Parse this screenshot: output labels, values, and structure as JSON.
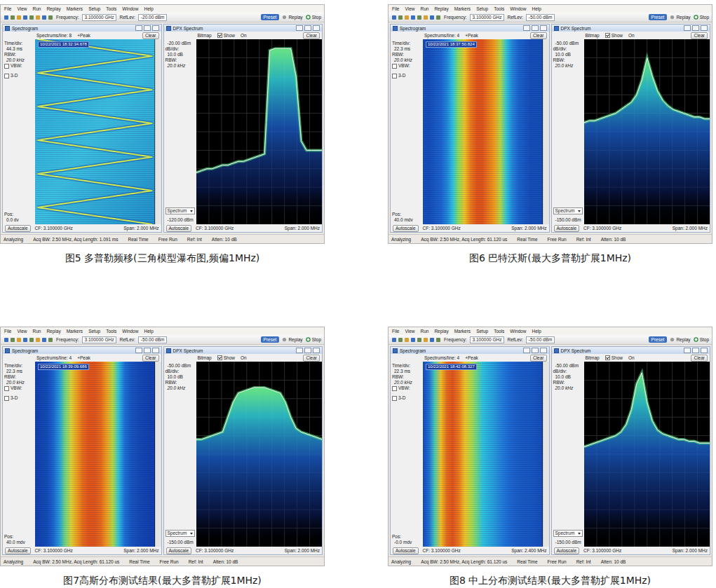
{
  "figures": [
    {
      "caption": "图5 多普勒频移(三角模型瀑布图,频偏1MHz)",
      "menu": [
        "File",
        "View",
        "Run",
        "Replay",
        "Markers",
        "Setup",
        "Tools",
        "Window",
        "Help"
      ],
      "toolbar": {
        "frequency_label": "Frequency:",
        "frequency": "3.100000 GHz",
        "reflev_label": "RefLev:",
        "reflev": "-20.00 dBm",
        "preset": "Preset",
        "replay": "Replay",
        "stop": "Stop"
      },
      "spectrogram": {
        "title": "Spectrogram",
        "spectrums_line": "Spectrums/line: 8",
        "detector": "+Peak",
        "clear": "Clear",
        "time_div_label": "Time/div:",
        "time_div": "44.3 ms",
        "rbw_label": "RBW:",
        "rbw": "20.0 kHz",
        "vbw_label": "VBW:",
        "vbw_checked": false,
        "three_d_label": "3-D",
        "three_d_checked": false,
        "pos_label": "Pos:",
        "pos": "0.0 dv",
        "timestamp": "10/22/2021 18:32:34.678",
        "autoscale": "Autoscale",
        "cf": "CF: 3.100000 GHz",
        "span": "Span: 2.000 MHz",
        "kind": "sweep",
        "track": [
          0.02,
          0.98,
          0.02,
          0.98,
          0.02,
          0.98,
          0.02,
          0.98,
          0.02,
          0.98,
          0.02,
          0.98
        ]
      },
      "dpx": {
        "title": "DPX Spectrum",
        "bitmap": "Bitmap",
        "show_label": "Show",
        "show_checked": true,
        "on": "On",
        "clear": "Clear",
        "ref_level": "-20.00 dBm",
        "db_div_label": "dB/div:",
        "db_div": "10.0 dB",
        "rbw_label": "RBW:",
        "rbw": "20.0 kHz",
        "trace_select": "Spectrum",
        "bottom_level": "-120.00 dBm",
        "autoscale": "Autoscale",
        "cf": "CF: 3.100000 GHz",
        "span": "Span: 2.000 MHz",
        "top_dbm": -20,
        "bottom_dbm": -120,
        "trace": [
          -92,
          -91,
          -90,
          -90,
          -89,
          -88,
          -88,
          -87,
          -86,
          -86,
          -85,
          -84,
          -83,
          -82,
          -26,
          -25,
          -25,
          -25,
          -25,
          -40,
          -75,
          -80,
          -80,
          -80,
          -80
        ]
      },
      "status": [
        "Analyzing",
        "Acq BW: 2.50 MHz, Acq Length: 1.091 ms",
        "Real Time",
        "Free Run",
        "Ref: Int",
        "Atten: 10 dB"
      ]
    },
    {
      "caption": "图6 巴特沃斯(最大多普勒扩展1MHz)",
      "menu": [
        "File",
        "View",
        "Run",
        "Replay",
        "Markers",
        "Setup",
        "Tools",
        "Window",
        "Help"
      ],
      "toolbar": {
        "frequency_label": "Frequency:",
        "frequency": "3.100000 GHz",
        "reflev_label": "RefLev:",
        "reflev": "-50.00 dBm",
        "preset": "Preset",
        "replay": "Replay",
        "stop": "Stop"
      },
      "spectrogram": {
        "title": "Spectrogram",
        "spectrums_line": "Spectrums/line: 4",
        "detector": "+Peak",
        "clear": "Clear",
        "time_div_label": "Time/div:",
        "time_div": "22.3 ms",
        "rbw_label": "RBW:",
        "rbw": "20.0 kHz",
        "vbw_label": "VBW:",
        "vbw_checked": false,
        "three_d_label": "3-D",
        "three_d_checked": false,
        "pos_label": "Pos:",
        "pos": "40.0 mdv",
        "timestamp": "10/22/2021 18:37:50.824",
        "autoscale": "Autoscale",
        "cf": "CF: 3.100000 GHz",
        "span": "Span: 2.000 MHz",
        "kind": "band",
        "profile": [
          0.15,
          0.15,
          0.2,
          0.25,
          0.35,
          0.5,
          0.65,
          0.8,
          0.9,
          0.95,
          0.95,
          0.9,
          0.85,
          0.7,
          0.5,
          0.35,
          0.25,
          0.2,
          0.15,
          0.15,
          0.15
        ]
      },
      "dpx": {
        "title": "DPX Spectrum",
        "bitmap": "Bitmap",
        "show_label": "Show",
        "show_checked": true,
        "on": "On",
        "clear": "Clear",
        "ref_level": "-50.00 dBm",
        "db_div_label": "dB/div:",
        "db_div": "10.0 dB",
        "rbw_label": "RBW:",
        "rbw": "20.0 kHz",
        "trace_select": "Spectrum",
        "bottom_level": "-150.00 dBm",
        "autoscale": "Autoscale",
        "cf": "CF: 3.100000 GHz",
        "span": "Span: 2.000 MHz",
        "top_dbm": -50,
        "bottom_dbm": -150,
        "trace": [
          -95,
          -94,
          -94,
          -93,
          -92,
          -91,
          -90,
          -88,
          -86,
          -84,
          -80,
          -72,
          -60,
          -70,
          -78,
          -83,
          -86,
          -88,
          -89,
          -90,
          -91,
          -92,
          -92,
          -93,
          -93
        ]
      },
      "status": [
        "Analyzing",
        "Acq BW: 2.50 MHz, Acq Length: 61.120 us",
        "Real Time",
        "Free Run",
        "Ref: Int",
        "Atten: 10 dB"
      ]
    },
    {
      "caption": "图7高斯分布测试结果(最大多普勒扩展1MHz)",
      "menu": [
        "File",
        "View",
        "Run",
        "Replay",
        "Markers",
        "Setup",
        "Tools",
        "Window",
        "Help"
      ],
      "toolbar": {
        "frequency_label": "Frequency:",
        "frequency": "3.100000 GHz",
        "reflev_label": "RefLev:",
        "reflev": "-50.00 dBm",
        "preset": "Preset",
        "replay": "Replay",
        "stop": "Stop"
      },
      "spectrogram": {
        "title": "Spectrogram",
        "spectrums_line": "Spectrums/line: 4",
        "detector": "+Peak",
        "clear": "Clear",
        "time_div_label": "Time/div:",
        "time_div": "22.3 ms",
        "rbw_label": "RBW:",
        "rbw": "20.0 kHz",
        "vbw_label": "VBW:",
        "vbw_checked": false,
        "three_d_label": "3-D",
        "three_d_checked": false,
        "pos_label": "Pos:",
        "pos": "40.0 mdv",
        "timestamp": "10/22/2021 18:39:09.686",
        "autoscale": "Autoscale",
        "cf": "CF: 3.100000 GHz",
        "span": "Span: 2.000 MHz",
        "kind": "band",
        "profile": [
          0.1,
          0.12,
          0.15,
          0.25,
          0.4,
          0.6,
          0.75,
          0.85,
          0.92,
          0.95,
          0.95,
          0.92,
          0.85,
          0.7,
          0.5,
          0.3,
          0.2,
          0.15,
          0.12,
          0.1,
          0.1
        ]
      },
      "dpx": {
        "title": "DPX Spectrum",
        "bitmap": "Bitmap",
        "show_label": "Show",
        "show_checked": true,
        "on": "On",
        "clear": "Clear",
        "ref_level": "-50.00 dBm",
        "db_div_label": "dB/div:",
        "db_div": "10.0 dB",
        "rbw_label": "RBW:",
        "rbw": "20.0 kHz",
        "trace_select": "Spectrum",
        "bottom_level": "-150.00 dBm",
        "autoscale": "Autoscale",
        "cf": "CF: 3.100000 GHz",
        "span": "Span: 2.000 MHz",
        "top_dbm": -50,
        "bottom_dbm": -150,
        "trace": [
          -92,
          -92,
          -91,
          -90,
          -89,
          -88,
          -80,
          -72,
          -67,
          -66,
          -65,
          -64,
          -64,
          -64,
          -65,
          -66,
          -67,
          -72,
          -80,
          -86,
          -88,
          -89,
          -90,
          -91,
          -92
        ]
      },
      "status": [
        "Analyzing",
        "Acq BW: 2.50 MHz, Acq Length: 61.120 us",
        "Real Time",
        "Free Run",
        "Ref: Int",
        "Atten: 10 dB"
      ]
    },
    {
      "caption": "图8 中上分布测试结果(最大多普勒扩展1MHz)",
      "menu": [
        "File",
        "View",
        "Run",
        "Replay",
        "Markers",
        "Setup",
        "Tools",
        "Window",
        "Help"
      ],
      "toolbar": {
        "frequency_label": "Frequency:",
        "frequency": "3.100000 GHz",
        "reflev_label": "RefLev:",
        "reflev": "-50.00 dBm",
        "preset": "Preset",
        "replay": "Replay",
        "stop": "Stop"
      },
      "spectrogram": {
        "title": "Spectrogram",
        "spectrums_line": "Spectrums/line: 4",
        "detector": "+Peak",
        "clear": "Clear",
        "time_div_label": "Time/div:",
        "time_div": "22.3 ms",
        "rbw_label": "RBW:",
        "rbw": "20.0 kHz",
        "vbw_label": "VBW:",
        "vbw_checked": false,
        "three_d_label": "3-D",
        "three_d_checked": false,
        "pos_label": "Pos:",
        "pos": "-0.0 mdv",
        "timestamp": "10/22/2021 18:42:08.327",
        "autoscale": "Autoscale",
        "cf": "CF: 3.100000 GHz",
        "span": "Span: 2.400 MHz",
        "kind": "band",
        "profile": [
          0.15,
          0.3,
          0.55,
          0.8,
          0.92,
          0.95,
          0.9,
          0.8,
          0.7,
          0.6,
          0.5,
          0.45,
          0.4,
          0.35,
          0.3,
          0.25,
          0.22,
          0.2,
          0.2,
          0.18,
          0.15
        ]
      },
      "dpx": {
        "title": "DPX Spectrum",
        "bitmap": "Bitmap",
        "show_label": "Show",
        "show_checked": true,
        "on": "On",
        "clear": "Clear",
        "ref_level": "-50.00 dBm",
        "db_div_label": "dB/div:",
        "db_div": "10.0 dB",
        "rbw_label": "RBW:",
        "rbw": "20.0 kHz",
        "trace_select": "Spectrum",
        "bottom_level": "-150.00 dBm",
        "autoscale": "Autoscale",
        "cf": "CF: 3.100000 GHz",
        "span": "Span: 2.000 MHz",
        "top_dbm": -50,
        "bottom_dbm": -150,
        "trace": [
          -96,
          -95,
          -94,
          -93,
          -92,
          -91,
          -90,
          -88,
          -84,
          -76,
          -62,
          -56,
          -72,
          -82,
          -87,
          -89,
          -90,
          -91,
          -92,
          -92,
          -93,
          -93,
          -94,
          -94,
          -94
        ]
      },
      "status": [
        "Analyzing",
        "Acq BW: 2.50 MHz, Acq Length: 61.120 us",
        "Real Time",
        "Free Run",
        "Ref: Int",
        "Atten: 10 dB"
      ]
    }
  ]
}
